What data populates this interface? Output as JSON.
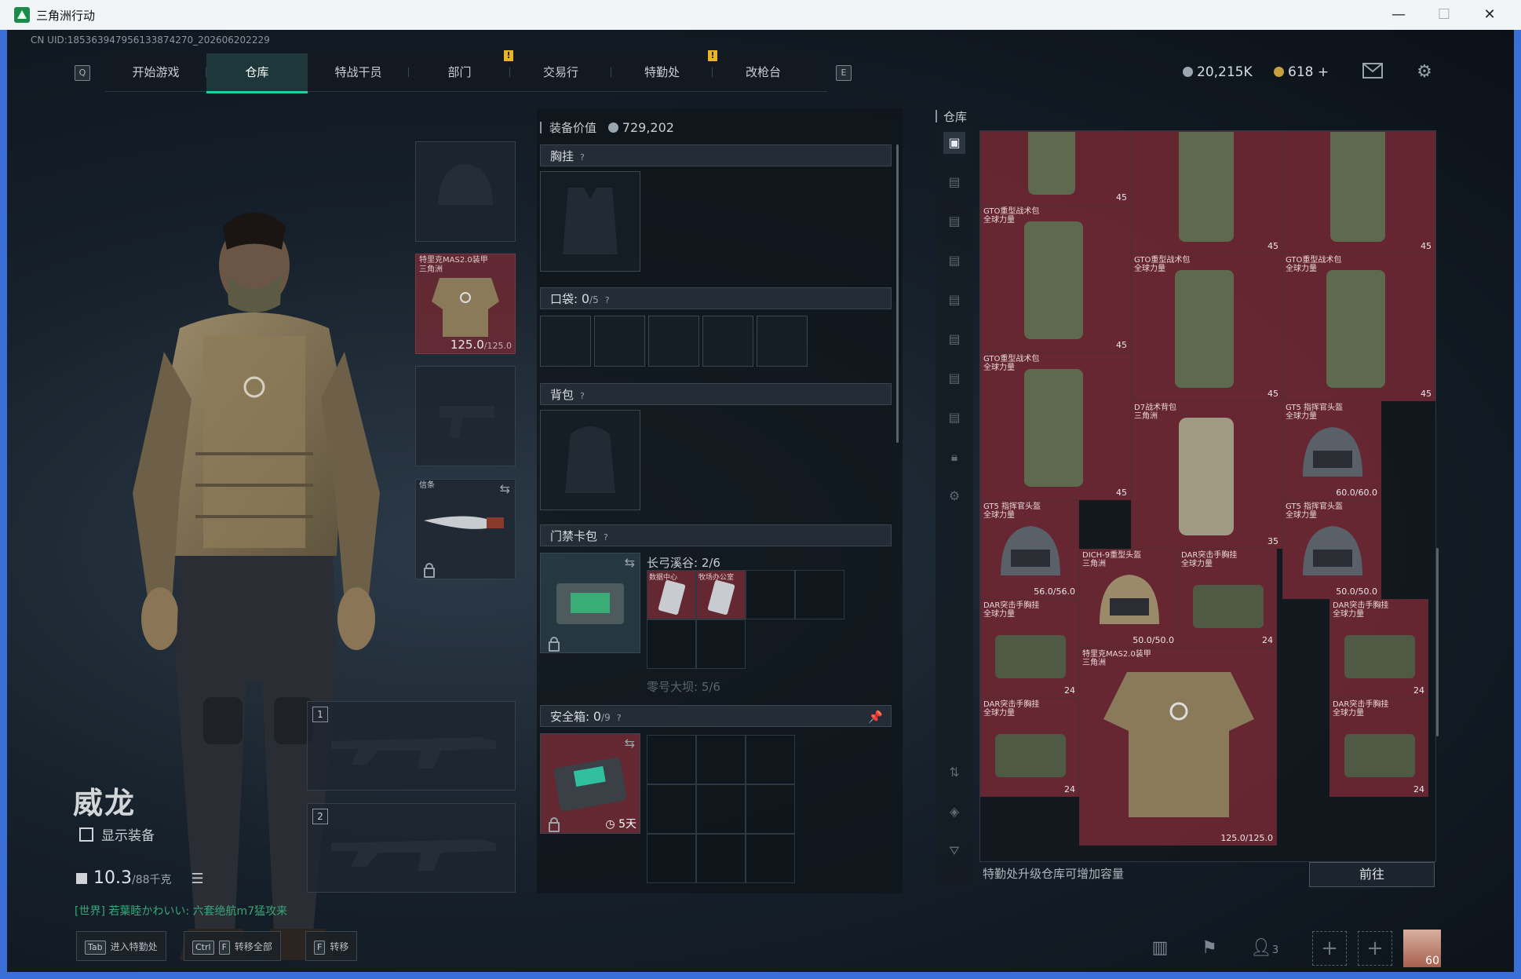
{
  "window": {
    "title": "三角洲行动",
    "min": "—",
    "max": "☐",
    "close": "✕"
  },
  "uid": "CN UID:1853639479561338742​70_202606202229",
  "nav": {
    "key_left": "Q",
    "key_right": "E",
    "tabs": [
      "开始游戏",
      "仓库",
      "特战干员",
      "部门",
      "交易行",
      "特勤处",
      "改枪台"
    ],
    "active": "仓库",
    "alert": "!"
  },
  "currency": {
    "silver": "20,215K",
    "gold": "618",
    "gold_add": "+"
  },
  "operator": {
    "name": "威龙",
    "show_gear": "显示装备",
    "weight": "10.3",
    "weight_max": "/88千克"
  },
  "chat": {
    "channel": "[世界]",
    "text": "若葉睦かわいい: 六套绝航m7猛攻来"
  },
  "slots": {
    "armor": {
      "label": "特里克MAS2.0装甲\n三角洲",
      "durability": "125.0",
      "durability_max": "/125.0"
    },
    "melee": {
      "label": "信条"
    },
    "weapon1": "1",
    "weapon2": "2"
  },
  "middle": {
    "equip_value_label": "装备价值",
    "equip_value": "729,202",
    "chest_rig": "胸挂",
    "pocket": "口袋:",
    "pocket_count": "0",
    "pocket_max": "/5",
    "backpack": "背包",
    "keycard": "门禁卡包",
    "keycard_map1": "长弓溪谷: 2/6",
    "keycard_map2": "零号大坝: 5/6",
    "key1": "数据中心",
    "key2": "牧场办公室",
    "safebox": "安全箱:",
    "safebox_count": "0",
    "safebox_max": "/9",
    "safebox_time": "5天",
    "help": "?"
  },
  "warehouse": {
    "title": "仓库",
    "footer": "特勤处升级仓库可增加容量",
    "go_button": "前往",
    "items": [
      {
        "name": "",
        "count": "45"
      },
      {
        "name": "",
        "count": "45"
      },
      {
        "name": "",
        "count": "45"
      },
      {
        "name": "GTO重型战术包\n全球力量",
        "count": "45"
      },
      {
        "name": "GTO重型战术包\n全球力量",
        "count": "45"
      },
      {
        "name": "GTO重型战术包\n全球力量",
        "count": "45"
      },
      {
        "name": "GTO重型战术包\n全球力量",
        "count": "45"
      },
      {
        "name": "D7战术背包\n三角洲",
        "count": "35"
      },
      {
        "name": "GT5 指挥官头盔\n全球力量",
        "count": "60.0/60.0"
      },
      {
        "name": "GT5 指挥官头盔\n全球力量",
        "count": "56.0/56.0"
      },
      {
        "name": "DICH-9重型头盔\n三角洲",
        "count": "50.0/50.0"
      },
      {
        "name": "DAR突击手胸挂\n全球力量",
        "count": "24"
      },
      {
        "name": "GT5 指挥官头盔\n全球力量",
        "count": "50.0/50.0"
      },
      {
        "name": "DAR突击手胸挂\n全球力量",
        "count": "24"
      },
      {
        "name": "特里克MAS2.0装甲\n三角洲",
        "count": "125.0/125.0"
      },
      {
        "name": "DAR突击手胸挂\n全球力量",
        "count": "24"
      },
      {
        "name": "DAR突击手胸挂\n全球力量",
        "count": "24"
      },
      {
        "name": "DAR突击手胸挂\n全球力量",
        "count": "24"
      }
    ]
  },
  "bottom": {
    "hint1_key": "Tab",
    "hint1": "进入特勤处",
    "hint2_key1": "Ctrl",
    "hint2_key2": "F",
    "hint2": "转移全部",
    "hint3_key": "F",
    "hint3": "转移",
    "team_count": "3",
    "level": "60"
  },
  "colors": {
    "accent": "#1ed0a0",
    "item_bg": "#70283a",
    "alert": "#e8b52a"
  }
}
